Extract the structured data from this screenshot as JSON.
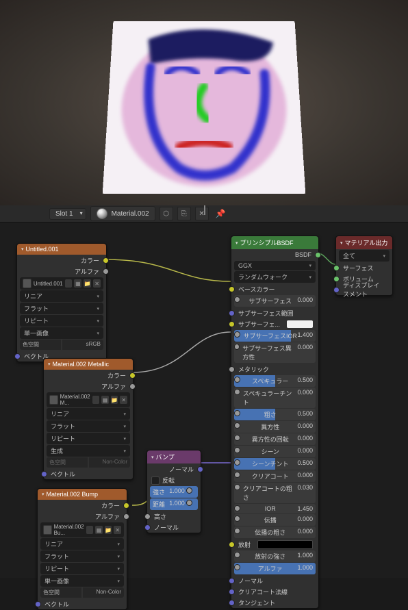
{
  "viewport": {
    "description": "3D-face-painting-render"
  },
  "toolbar": {
    "slot_label": "Slot 1",
    "material_name": "Material.002",
    "btn_shield": "⬡",
    "btn_copy": "⎘",
    "btn_close": "✕",
    "btn_pin": "📌"
  },
  "nodes": {
    "tex1": {
      "title": "Untitled.001",
      "out_color": "カラー",
      "out_alpha": "アルファ",
      "image": "Untitled.001",
      "linear": "リニア",
      "flat": "フラット",
      "repeat": "リピート",
      "single": "単一画像",
      "colorspace_label": "色空間",
      "colorspace_value": "sRGB",
      "vector": "ベクトル"
    },
    "tex2": {
      "title": "Material.002 Metallic",
      "out_color": "カラー",
      "out_alpha": "アルファ",
      "image": "Material.002 M...",
      "linear": "リニア",
      "flat": "フラット",
      "repeat": "リピート",
      "generated": "生成",
      "colorspace_label": "色空間",
      "colorspace_value": "Non-Color",
      "vector": "ベクトル"
    },
    "tex3": {
      "title": "Material.002 Bump",
      "out_color": "カラー",
      "out_alpha": "アルファ",
      "image": "Material.002 Bu...",
      "linear": "リニア",
      "flat": "フラット",
      "repeat": "リピート",
      "single": "単一画像",
      "colorspace_label": "色空間",
      "colorspace_value": "Non-Color",
      "vector": "ベクトル"
    },
    "bump": {
      "title": "バンプ",
      "out_normal": "ノーマル",
      "invert": "反転",
      "strength_label": "強さ",
      "strength_value": "1.000",
      "distance_label": "距離",
      "distance_value": "1.000",
      "height": "高さ",
      "normal": "ノーマル"
    },
    "principled": {
      "title": "プリンシプルBSDF",
      "out_bsdf": "BSDF",
      "dist": "GGX",
      "sss_method": "ランダムウォーク",
      "base_color": "ベースカラー",
      "subsurface_label": "サブサーフェス",
      "subsurface_value": "0.000",
      "sss_radius": "サブサーフェス範囲",
      "sss_color": "サブサーフェ...",
      "sss_ior_label": "サブサーフェスIOR",
      "sss_ior_value": "1.400",
      "sss_aniso_label": "サブサーフェス異方性",
      "sss_aniso_value": "0.000",
      "metallic": "メタリック",
      "specular_label": "スペキュラー",
      "specular_value": "0.500",
      "spec_tint_label": "スペキュラーチント",
      "spec_tint_value": "0.000",
      "roughness_label": "粗さ",
      "roughness_value": "0.500",
      "aniso_label": "異方性",
      "aniso_value": "0.000",
      "aniso_rot_label": "異方性の回転",
      "aniso_rot_value": "0.000",
      "sheen_label": "シーン",
      "sheen_value": "0.000",
      "sheen_tint_label": "シーンチント",
      "sheen_tint_value": "0.500",
      "clearcoat_label": "クリアコート",
      "clearcoat_value": "0.000",
      "cc_rough_label": "クリアコートの粗さ",
      "cc_rough_value": "0.030",
      "ior_label": "IOR",
      "ior_value": "1.450",
      "transmission_label": "伝播",
      "transmission_value": "0.000",
      "trans_rough_label": "伝播の粗さ",
      "trans_rough_value": "0.000",
      "emission": "放射",
      "emit_strength_label": "放射の強さ",
      "emit_strength_value": "1.000",
      "alpha_label": "アルファ",
      "alpha_value": "1.000",
      "normal": "ノーマル",
      "cc_normal": "クリアコート法線",
      "tangent": "タンジェント"
    },
    "output": {
      "title": "マテリアル出力",
      "target": "全て",
      "surface": "サーフェス",
      "volume": "ボリューム",
      "displacement": "ディスプレイスメント"
    }
  }
}
